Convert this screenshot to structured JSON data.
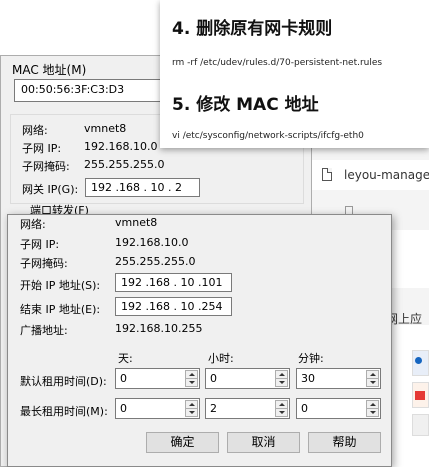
{
  "background": {
    "file_name": "leyou-manage-w",
    "web_label": "网上应"
  },
  "mac_dialog": {
    "mac_label": "MAC 地址(M)",
    "mac_value": "00:50:56:3F:C3:D3",
    "network_label": "网络:",
    "network_value": "vmnet8",
    "subnet_ip_label": "子网 IP:",
    "subnet_ip_value": "192.168.10.0",
    "subnet_mask_label": "子网掩码:",
    "subnet_mask_value": "255.255.255.0",
    "gateway_label": "网关 IP(G):",
    "gateway_value": "192 .168 . 10 .  2",
    "port_forward_label": "端口转发(F)"
  },
  "note": {
    "step4_title": "4.  删除原有网卡规则",
    "step4_cmd": "rm  -rf /etc/udev/rules.d/70-persistent-net.rules",
    "step5_title": "5.  修改 MAC 地址",
    "step5_cmd": "vi /etc/sysconfig/network-scripts/ifcfg-eth0"
  },
  "dhcp_dialog": {
    "network_label": "网络:",
    "network_value": "vmnet8",
    "subnet_ip_label": "子网 IP:",
    "subnet_ip_value": "192.168.10.0",
    "subnet_mask_label": "子网掩码:",
    "subnet_mask_value": "255.255.255.0",
    "start_ip_label": "开始 IP 地址(S):",
    "start_ip_value": "192 .168 . 10 .101",
    "end_ip_label": "结束 IP 地址(E):",
    "end_ip_value": "192 .168 . 10 .254",
    "broadcast_label": "广播地址:",
    "broadcast_value": "192.168.10.255",
    "col_days": "天:",
    "col_hours": "小时:",
    "col_minutes": "分钟:",
    "default_lease_label": "默认租用时间(D):",
    "default_lease": {
      "days": "0",
      "hours": "0",
      "minutes": "30"
    },
    "max_lease_label": "最长租用时间(M):",
    "max_lease": {
      "days": "0",
      "hours": "2",
      "minutes": "0"
    },
    "ok_label": "确定",
    "cancel_label": "取消",
    "help_label": "帮助"
  }
}
